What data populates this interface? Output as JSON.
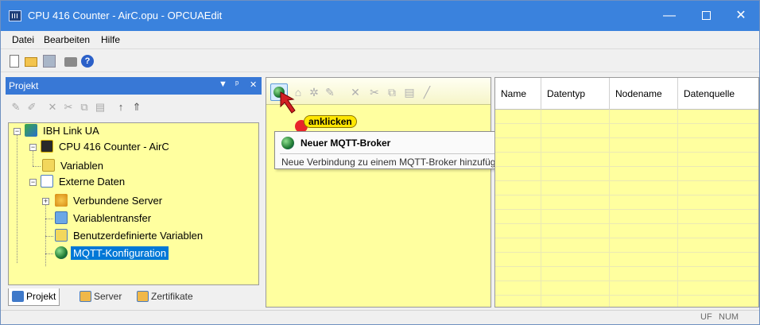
{
  "window": {
    "title": "CPU 416 Counter - AirC.opu - OPCUAEdit",
    "controls": {
      "minimize": "—",
      "maximize": "",
      "close": "✕"
    }
  },
  "menu": [
    "Datei",
    "Bearbeiten",
    "Hilfe"
  ],
  "project_panel": {
    "title": "Projekt",
    "header_buttons": {
      "dropdown": "▼",
      "pin": "ᵖ",
      "close": "✕"
    },
    "tree": [
      {
        "label": "IBH Link UA",
        "icon": "server-network-icon"
      },
      {
        "label": "CPU 416 Counter - AirC",
        "icon": "cpu-icon"
      },
      {
        "label": "Variablen",
        "icon": "table-icon"
      },
      {
        "label": "Externe Daten",
        "icon": "external-data-icon"
      },
      {
        "label": "Verbundene Server",
        "icon": "connected-servers-icon"
      },
      {
        "label": "Variablentransfer",
        "icon": "transfer-icon"
      },
      {
        "label": "Benutzerdefinierte Variablen",
        "icon": "custom-variables-icon"
      },
      {
        "label": "MQTT-Konfiguration",
        "icon": "globe-icon",
        "selected": true
      }
    ],
    "tabs": [
      {
        "label": "Projekt",
        "active": true
      },
      {
        "label": "Server",
        "active": false
      },
      {
        "label": "Zertifikate",
        "active": false
      }
    ]
  },
  "middle_panel": {
    "callout": "anklicken"
  },
  "tooltip": {
    "title": "Neuer MQTT-Broker",
    "description": "Neue Verbindung zu einem MQTT-Broker hinzufügen."
  },
  "grid": {
    "columns": [
      "Name",
      "Datentyp",
      "Nodename",
      "Datenquelle"
    ]
  },
  "statusbar": {
    "uf": "UF",
    "num": "NUM"
  },
  "colors": {
    "titlebar": "#3a82dd",
    "panel_background": "#ffff9f",
    "selection": "#0078d7",
    "callout": "#ffe600",
    "marker": "#e8242a"
  }
}
